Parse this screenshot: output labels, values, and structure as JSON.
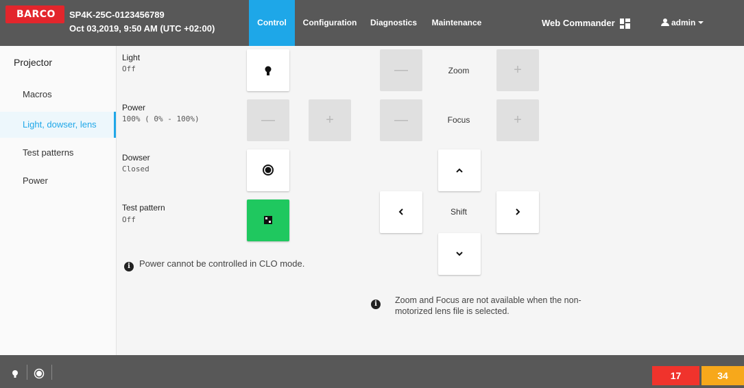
{
  "header": {
    "brand": "BARCO",
    "device_name": "SP4K-25C-0123456789",
    "datetime": "Oct 03,2019, 9:50 AM (UTC +02:00)",
    "tabs": [
      {
        "label": "Control",
        "active": true
      },
      {
        "label": "Configuration",
        "active": false
      },
      {
        "label": "Diagnostics",
        "active": false
      },
      {
        "label": "Maintenance",
        "active": false
      }
    ],
    "web_commander": "Web Commander",
    "user": "admin"
  },
  "sidebar": {
    "title": "Projector",
    "items": [
      {
        "label": "Macros",
        "active": false
      },
      {
        "label": "Light, dowser, lens",
        "active": true
      },
      {
        "label": "Test patterns",
        "active": false
      },
      {
        "label": "Power",
        "active": false
      }
    ]
  },
  "controls": {
    "light": {
      "label": "Light",
      "value": "Off"
    },
    "power": {
      "label": "Power",
      "value": "100% ( 0% - 100%)"
    },
    "dowser": {
      "label": "Dowser",
      "value": "Closed"
    },
    "test_pattern": {
      "label": "Test pattern",
      "value": "Off"
    },
    "minus": "—",
    "plus": "+",
    "power_note": "Power cannot be controlled in CLO mode."
  },
  "lens": {
    "zoom_label": "Zoom",
    "focus_label": "Focus",
    "shift_label": "Shift",
    "note_line1": "Zoom and Focus are not available when the non-",
    "note_line2": "motorized lens file is selected."
  },
  "footer": {
    "error_count": "17",
    "warning_count": "34"
  },
  "colors": {
    "accent": "#1ea7e8",
    "brand": "#e3262c",
    "test_pattern_green": "#1fc85f",
    "error": "#f0332c",
    "warning": "#f7a81b"
  }
}
